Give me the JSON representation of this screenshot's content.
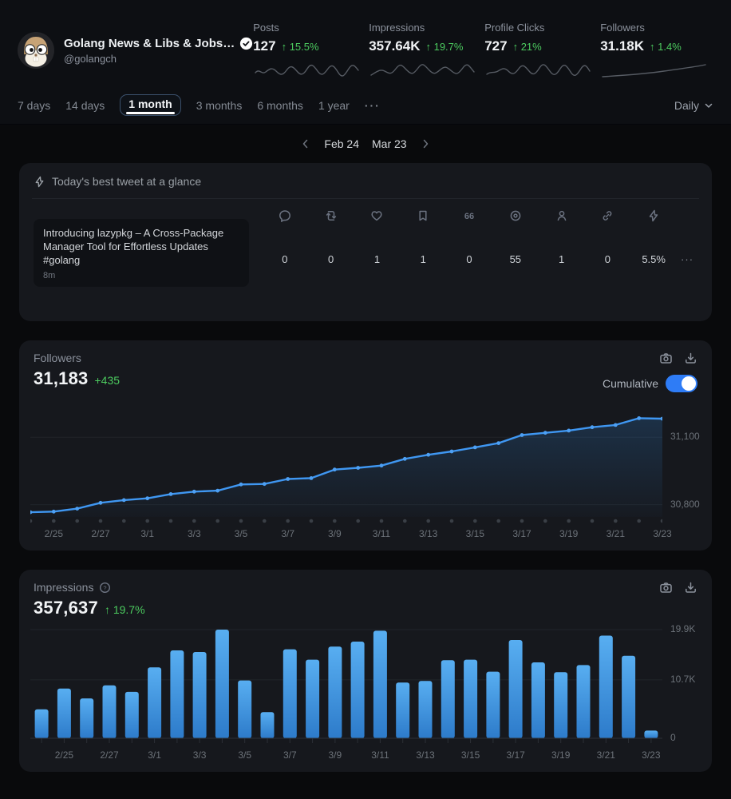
{
  "header": {
    "account": {
      "name": "Golang News & Libs & Jobs…",
      "handle": "@golangch"
    },
    "stats": [
      {
        "label": "Posts",
        "value": "127",
        "delta": "↑ 15.5%"
      },
      {
        "label": "Impressions",
        "value": "357.64K",
        "delta": "↑ 19.7%"
      },
      {
        "label": "Profile Clicks",
        "value": "727",
        "delta": "↑ 21%"
      },
      {
        "label": "Followers",
        "value": "31.18K",
        "delta": "↑ 1.4%"
      }
    ],
    "ranges": [
      "7 days",
      "14 days",
      "1 month",
      "3 months",
      "6 months",
      "1 year"
    ],
    "selected_range": "1 month",
    "more_label": "···",
    "granularity": "Daily"
  },
  "datenav": {
    "start": "Feb 24",
    "end": "Mar 23"
  },
  "tweet_card": {
    "title": "Today's best tweet at a glance",
    "tweet": {
      "text": "Introducing lazypkg – A Cross-Package Manager Tool for Effortless Updates #golang",
      "time": "8m"
    },
    "metrics": [
      {
        "icon": "reply-icon",
        "value": "0"
      },
      {
        "icon": "retweet-icon",
        "value": "0"
      },
      {
        "icon": "like-icon",
        "value": "1"
      },
      {
        "icon": "bookmark-icon",
        "value": "1"
      },
      {
        "icon": "quote-icon",
        "value": "0"
      },
      {
        "icon": "views-icon",
        "value": "55"
      },
      {
        "icon": "profile-visits-icon",
        "value": "1"
      },
      {
        "icon": "link-clicks-icon",
        "value": "0"
      },
      {
        "icon": "engagement-rate-icon",
        "value": "5.5%"
      }
    ],
    "more": "···"
  },
  "followers_card": {
    "title": "Followers",
    "value": "31,183",
    "delta": "+435",
    "toggle_label": "Cumulative",
    "toggle_on": true
  },
  "impressions_card": {
    "title": "Impressions",
    "value": "357,637",
    "delta": "↑ 19.7%"
  },
  "colors": {
    "green": "#4ccb5f",
    "line_blue": "#3f97f2",
    "bar_blue_top": "#58aef1",
    "bar_blue_bottom": "#2d7bca",
    "toggle_blue": "#2e7cf6",
    "card_bg": "#16181d"
  },
  "chart_data": [
    {
      "type": "line",
      "name": "followers_cumulative",
      "title": "Followers",
      "legend": "Cumulative",
      "x": [
        "2/24",
        "2/25",
        "2/26",
        "2/27",
        "2/28",
        "3/1",
        "3/2",
        "3/3",
        "3/4",
        "3/5",
        "3/6",
        "3/7",
        "3/8",
        "3/9",
        "3/10",
        "3/11",
        "3/12",
        "3/13",
        "3/14",
        "3/15",
        "3/16",
        "3/17",
        "3/18",
        "3/19",
        "3/20",
        "3/21",
        "3/22",
        "3/23"
      ],
      "values": [
        30766,
        30769,
        30782,
        30808,
        30820,
        30828,
        30847,
        30858,
        30862,
        30890,
        30892,
        30914,
        30918,
        30956,
        30964,
        30974,
        31004,
        31022,
        31037,
        31055,
        31074,
        31110,
        31120,
        31130,
        31145,
        31155,
        31185,
        31183
      ],
      "ylim": [
        30745,
        31215
      ],
      "yticks": [
        {
          "label": "31,100",
          "value": 31100
        },
        {
          "label": "30,800",
          "value": 30800
        }
      ],
      "xtick_labels": [
        "2/25",
        "2/27",
        "3/1",
        "3/3",
        "3/5",
        "3/7",
        "3/9",
        "3/11",
        "3/13",
        "3/15",
        "3/17",
        "3/19",
        "3/21",
        "3/23"
      ],
      "grid": true,
      "legend_position": "top-right"
    },
    {
      "type": "bar",
      "name": "impressions_daily",
      "title": "Impressions",
      "x": [
        "2/24",
        "2/25",
        "2/26",
        "2/27",
        "2/28",
        "3/1",
        "3/2",
        "3/3",
        "3/4",
        "3/5",
        "3/6",
        "3/7",
        "3/8",
        "3/9",
        "3/10",
        "3/11",
        "3/12",
        "3/13",
        "3/14",
        "3/15",
        "3/16",
        "3/17",
        "3/18",
        "3/19",
        "3/20",
        "3/21",
        "3/22",
        "3/23"
      ],
      "values": [
        5300,
        9100,
        7300,
        9700,
        8500,
        13000,
        16100,
        15800,
        19900,
        10600,
        4800,
        16300,
        14400,
        16800,
        17700,
        19700,
        10200,
        10500,
        14300,
        14400,
        12200,
        18000,
        13900,
        12100,
        13400,
        18800,
        15100,
        1400
      ],
      "ylim": [
        0,
        19900
      ],
      "yticks": [
        {
          "label": "19.9K",
          "value": 19900
        },
        {
          "label": "10.7K",
          "value": 10700
        },
        {
          "label": "0",
          "value": 0
        }
      ],
      "xtick_labels": [
        "2/25",
        "2/27",
        "3/1",
        "3/3",
        "3/5",
        "3/7",
        "3/9",
        "3/11",
        "3/13",
        "3/15",
        "3/17",
        "3/19",
        "3/21",
        "3/23"
      ],
      "grid": true
    }
  ]
}
